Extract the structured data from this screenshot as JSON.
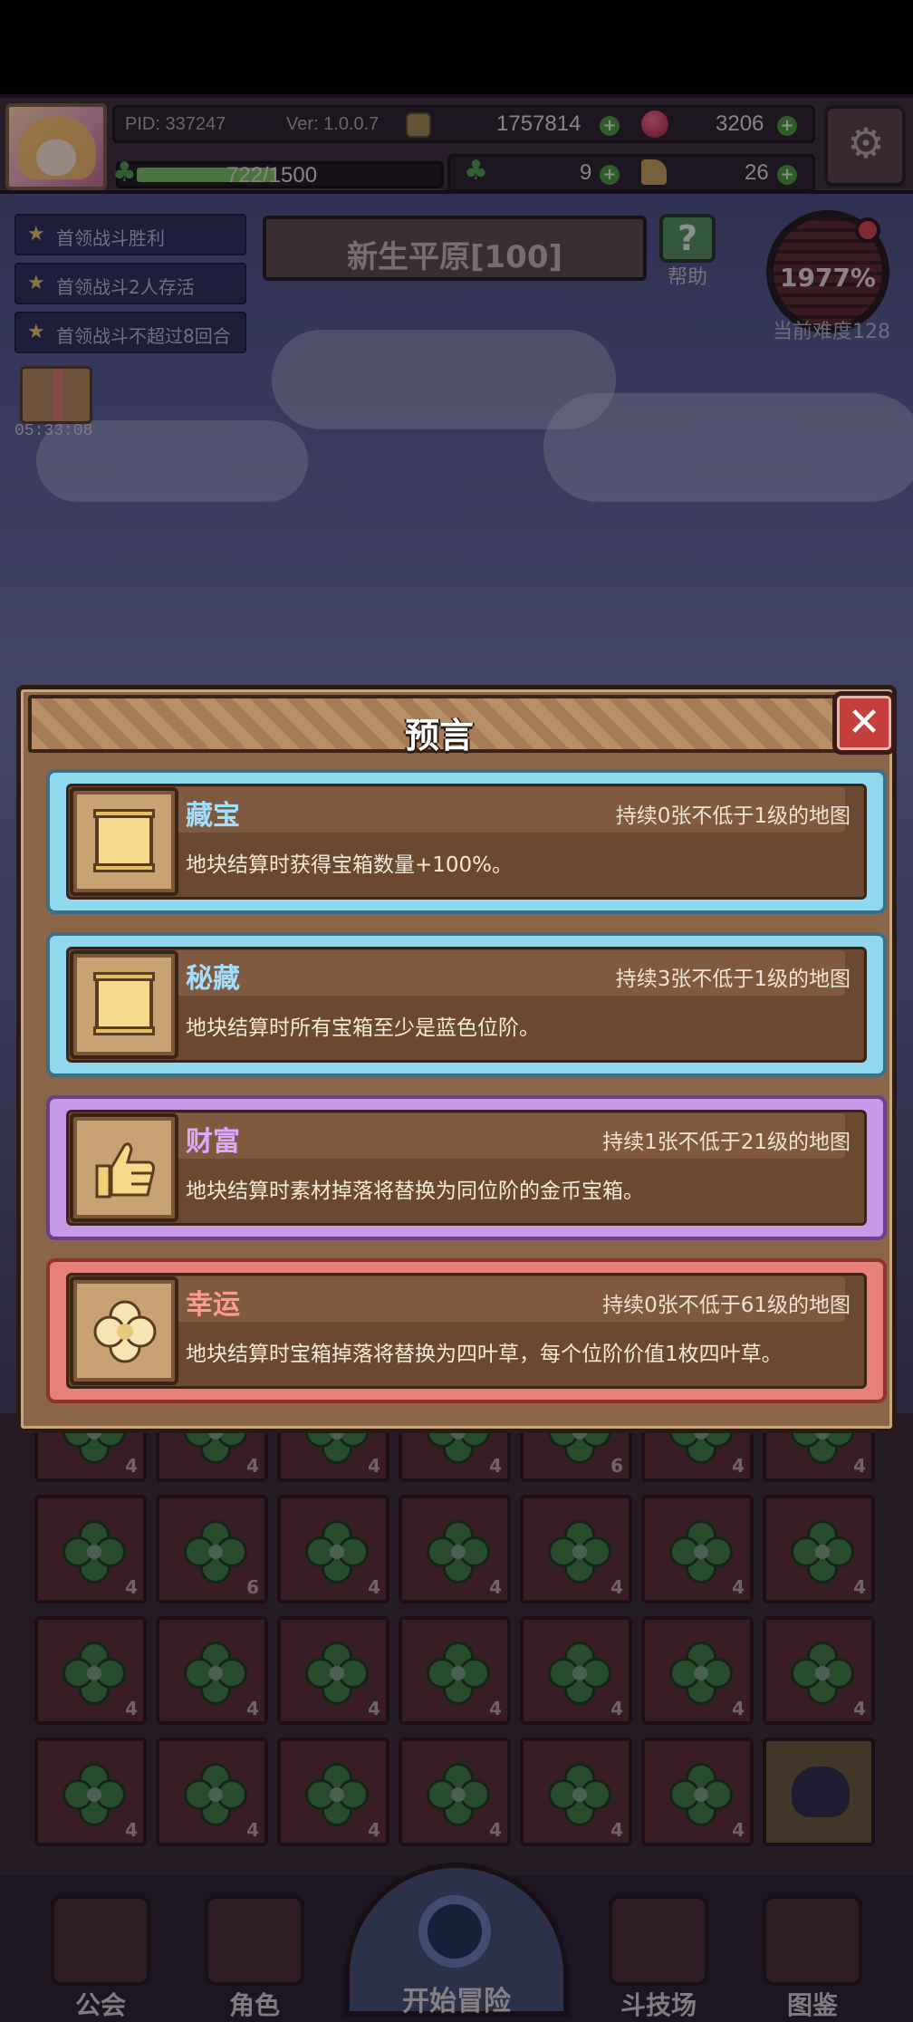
{
  "hud": {
    "pid": "PID: 337247",
    "version": "Ver: 1.0.0.7",
    "gold": "1757814",
    "gems": "3206",
    "energy": "722/1500",
    "energy_fraction": 0.48,
    "clovers": "9",
    "boots": "26"
  },
  "quests": [
    {
      "label": "首领战斗胜利"
    },
    {
      "label": "首领战斗2人存活"
    },
    {
      "label": "首领战斗不超过8回合"
    }
  ],
  "map": {
    "title": "新生平原[100]",
    "help_label": "帮助"
  },
  "difficulty": {
    "percent": "1977%",
    "label": "当前难度128"
  },
  "gift": {
    "timer": "05:33:08"
  },
  "board": {
    "rows": [
      [
        "4",
        "4",
        "4",
        "4",
        "6",
        "4",
        "4"
      ],
      [
        "4",
        "6",
        "4",
        "4",
        "4",
        "4",
        "4"
      ],
      [
        "4",
        "4",
        "4",
        "4",
        "4",
        "4",
        "4"
      ],
      [
        "4",
        "4",
        "4",
        "4",
        "4",
        "4",
        ""
      ]
    ]
  },
  "dialog": {
    "title": "预言",
    "close_icon": "✕",
    "cards": [
      {
        "name": "藏宝",
        "duration": "持续0张不低于1级的地图",
        "desc": "地块结算时获得宝箱数量+100%。",
        "icon": "scroll-icon",
        "color": "blue"
      },
      {
        "name": "秘藏",
        "duration": "持续3张不低于1级的地图",
        "desc": "地块结算时所有宝箱至少是蓝色位阶。",
        "icon": "scroll-icon",
        "color": "blue"
      },
      {
        "name": "财富",
        "duration": "持续1张不低于21级的地图",
        "desc": "地块结算时素材掉落将替换为同位阶的金币宝箱。",
        "icon": "thumbs-up-icon",
        "color": "purple"
      },
      {
        "name": "幸运",
        "duration": "持续0张不低于61级的地图",
        "desc": "地块结算时宝箱掉落将替换为四叶草，每个位阶价值1枚四叶草。",
        "icon": "clover-icon",
        "color": "red"
      }
    ]
  },
  "nav": {
    "guild": "公会",
    "character": "角色",
    "start": "开始冒险",
    "arena": "斗技场",
    "codex": "图鉴"
  }
}
